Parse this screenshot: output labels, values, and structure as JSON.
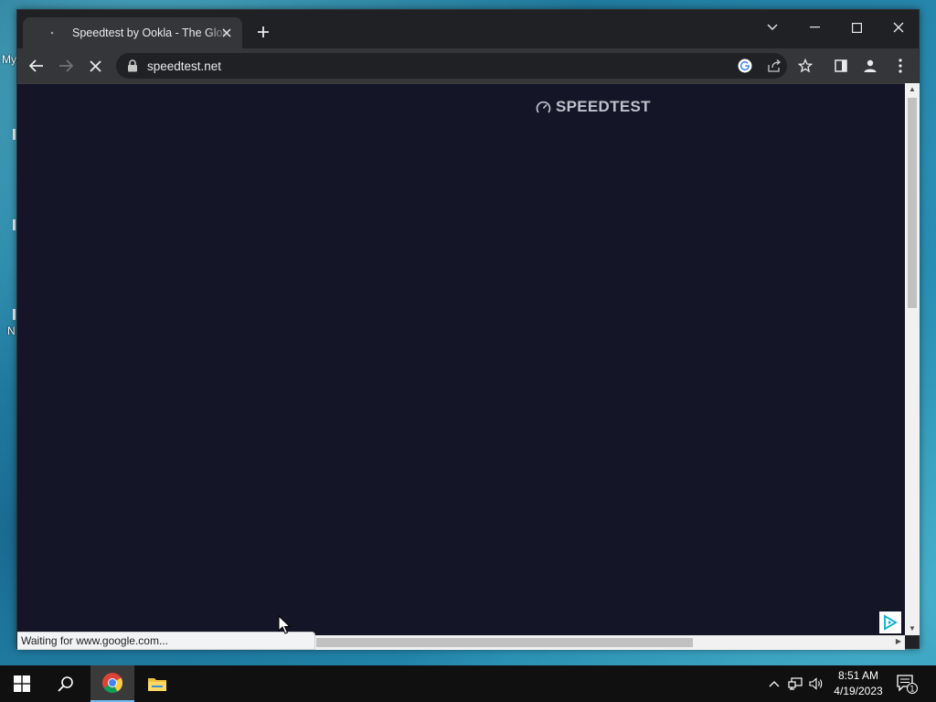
{
  "desktop": {
    "fragments": [
      "My",
      "N"
    ]
  },
  "browser": {
    "tab": {
      "title": "Speedtest by Ookla - The Global Broadband Speed Test",
      "close_icon": "close-icon",
      "favicon": "loading-spinner-icon"
    },
    "new_tab_icon": "plus-icon",
    "window_controls": [
      "tab-search-icon",
      "minimize-icon",
      "maximize-icon",
      "close-icon"
    ],
    "toolbar": {
      "back_icon": "arrow-left-icon",
      "forward_icon": "arrow-right-icon",
      "stop_icon": "stop-loading-icon",
      "url": "speedtest.net",
      "omnibox_icons": [
        "google-icon",
        "share-icon",
        "star-icon"
      ],
      "right_icons": [
        "side-panel-icon",
        "profile-icon",
        "kebab-menu-icon"
      ]
    },
    "page": {
      "logo_text": "SPEEDTEST",
      "background_color": "#141526",
      "logo_color": "#bfc1cc"
    },
    "status_text": "Waiting for www.google.com...",
    "ad_icon": "adchoices-icon"
  },
  "taskbar": {
    "items": [
      "windows-start-icon",
      "search-icon",
      "chrome-icon",
      "file-explorer-icon"
    ],
    "clock": {
      "time": "8:51 AM",
      "date": "4/19/2023"
    },
    "tray_icons": [
      "chevron-up-icon",
      "network-icon",
      "volume-icon"
    ],
    "notification_count": "1",
    "accent": "#76b9ed"
  }
}
